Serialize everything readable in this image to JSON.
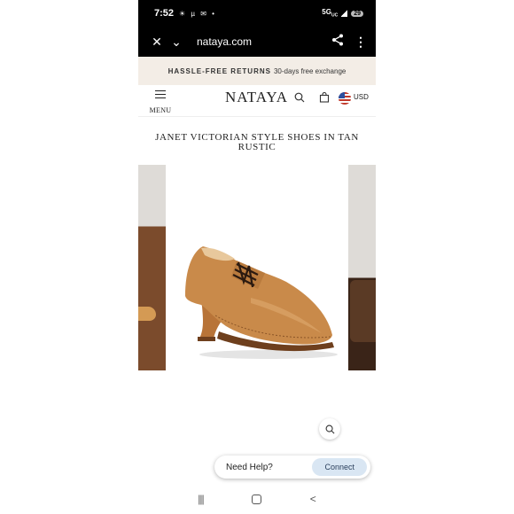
{
  "status_bar": {
    "time": "7:52",
    "notification_icons": "☀ µ ✉ •",
    "network": "5G",
    "network_sub": "UC",
    "battery": "29"
  },
  "browser": {
    "url": "nataya.com",
    "icons": [
      "close-icon",
      "chevron-down-icon",
      "share-icon",
      "more-vertical-icon"
    ]
  },
  "promo": {
    "bold": "HASSLE-FREE RETURNS",
    "text": "30-days free exchange"
  },
  "header": {
    "menu_label": "MENU",
    "logo": "NATAYA",
    "currency": "USD"
  },
  "product": {
    "title": "JANET VICTORIAN STYLE SHOES IN TAN RUSTIC"
  },
  "help": {
    "text": "Need Help?",
    "button": "Connect"
  },
  "colors": {
    "promo_bg": "#f3ede6",
    "leather": "#c98a4a",
    "connect_bg": "#d9e6f3"
  }
}
